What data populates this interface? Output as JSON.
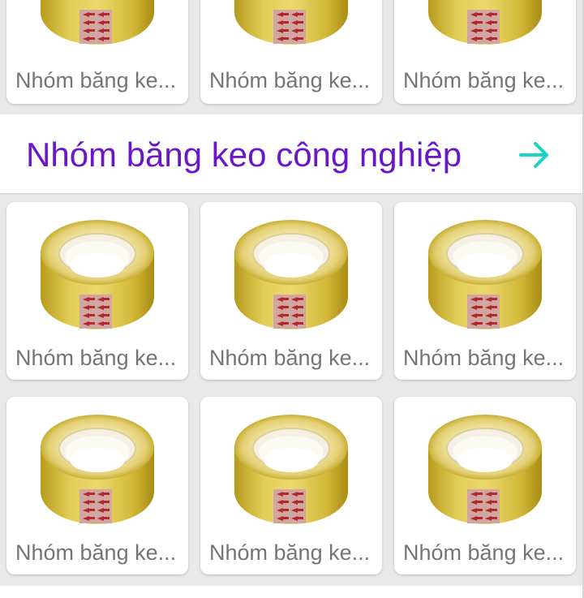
{
  "section": {
    "title": "Nhóm băng keo công nghiệp",
    "arrow_icon": "arrow-right-icon",
    "accent_color": "#6a16c9",
    "arrow_color": "#19d3c5"
  },
  "rows": [
    {
      "items": [
        {
          "label": "Nhóm băng ke...",
          "image": "tape-roll-image"
        },
        {
          "label": "Nhóm băng ke...",
          "image": "tape-roll-image"
        },
        {
          "label": "Nhóm băng ke...",
          "image": "tape-roll-image"
        }
      ]
    },
    {
      "items": [
        {
          "label": "Nhóm băng ke...",
          "image": "tape-roll-image"
        },
        {
          "label": "Nhóm băng ke...",
          "image": "tape-roll-image"
        },
        {
          "label": "Nhóm băng ke...",
          "image": "tape-roll-image"
        }
      ]
    },
    {
      "items": [
        {
          "label": "Nhóm băng ke...",
          "image": "tape-roll-image"
        },
        {
          "label": "Nhóm băng ke...",
          "image": "tape-roll-image"
        },
        {
          "label": "Nhóm băng ke...",
          "image": "tape-roll-image"
        }
      ]
    }
  ]
}
